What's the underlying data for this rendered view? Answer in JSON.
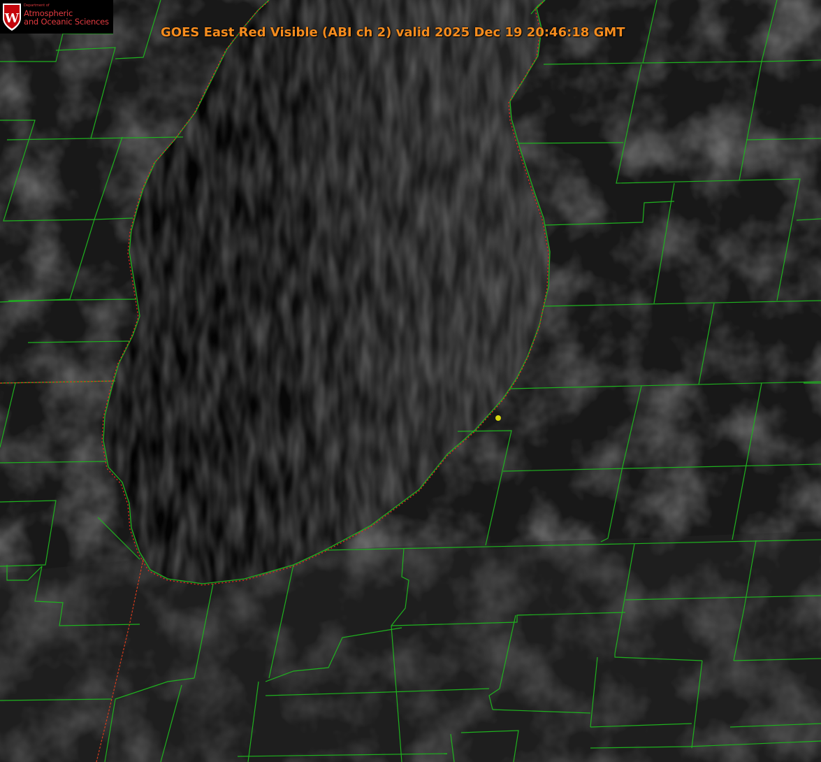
{
  "title": "GOES East Red Visible (ABI ch 2) valid 2025 Dec 19 20:46:18 GMT",
  "logo": {
    "department": "Department of",
    "line1": "Atmospheric",
    "line2": "and Oceanic Sciences",
    "mark": "W"
  },
  "colors": {
    "title_text": "#f58c1e",
    "county_borders": "#1fb21f",
    "state_border": "#d43b1c",
    "shoreline_dotted": "#e0281e",
    "station_marker": "#d4d40f",
    "logo_red": "#c5050c"
  },
  "imagery": {
    "type": "satellite-visible",
    "feature": "lake"
  }
}
